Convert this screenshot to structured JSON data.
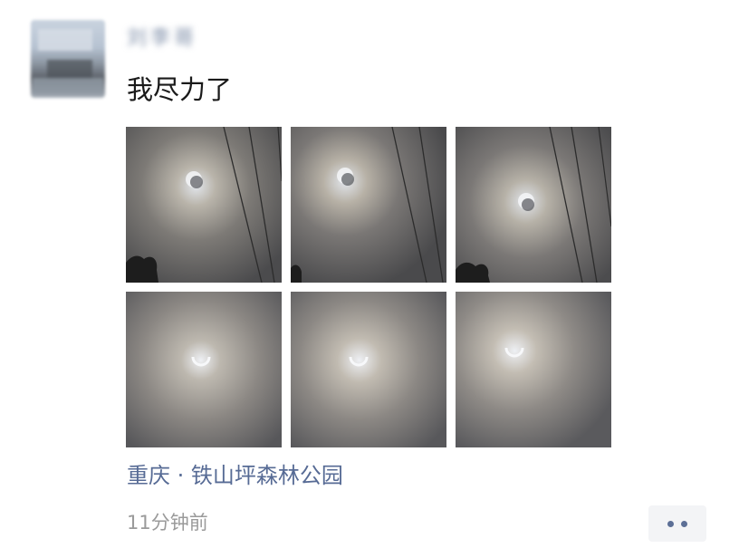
{
  "post": {
    "avatar_icon": "user-avatar-icon",
    "nickname": "刘李哥",
    "text": "我尽力了",
    "photos": [
      {
        "id": "photo-1",
        "icon": "solar-eclipse-photo",
        "row": 1,
        "col": 1
      },
      {
        "id": "photo-2",
        "icon": "solar-eclipse-photo",
        "row": 1,
        "col": 2
      },
      {
        "id": "photo-3",
        "icon": "solar-eclipse-photo",
        "row": 1,
        "col": 3
      },
      {
        "id": "photo-4",
        "icon": "solar-eclipse-photo",
        "row": 2,
        "col": 1
      },
      {
        "id": "photo-5",
        "icon": "solar-eclipse-photo",
        "row": 2,
        "col": 2
      },
      {
        "id": "photo-6",
        "icon": "solar-eclipse-photo",
        "row": 2,
        "col": 3
      }
    ],
    "location": "重庆 · 铁山坪森林公园",
    "time": "11分钟前",
    "more_icon": "more-dots-icon"
  },
  "colors": {
    "link": "#576b95",
    "text": "#1a1a1a",
    "muted": "#9a9a9a",
    "button_bg": "#f3f4f6"
  }
}
